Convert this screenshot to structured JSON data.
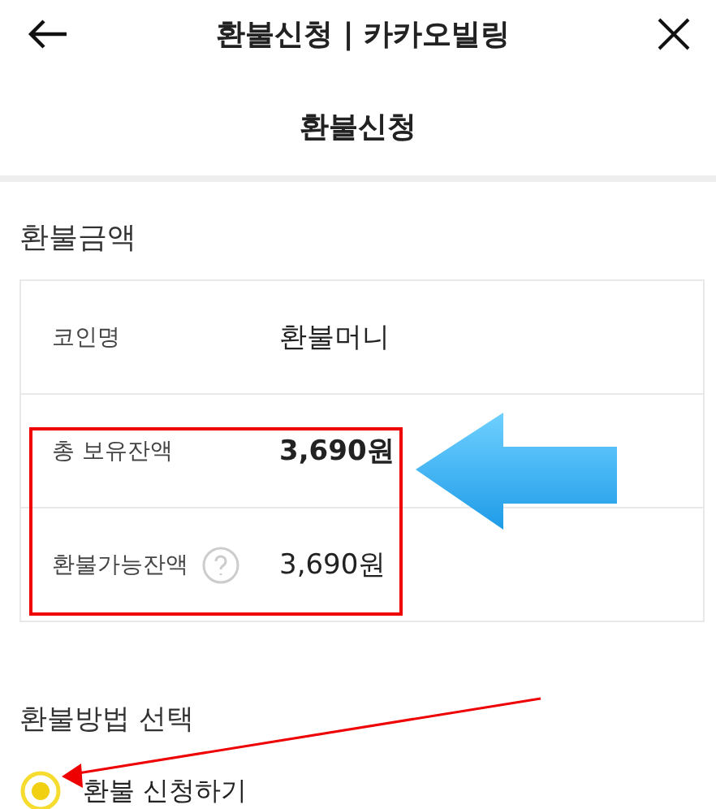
{
  "header": {
    "title": "환불신청 | 카카오빌링"
  },
  "page_title": "환불신청",
  "amount_section": {
    "heading": "환불금액",
    "rows": [
      {
        "label": "코인명",
        "value": "환불머니",
        "emphasis": false,
        "help": false
      },
      {
        "label": "총 보유잔액",
        "value": "3,690원",
        "emphasis": true,
        "help": false
      },
      {
        "label": "환불가능잔액",
        "value": "3,690원",
        "emphasis": false,
        "help": true
      }
    ]
  },
  "method_section": {
    "heading": "환불방법 선택",
    "options": [
      {
        "label": "환불 신청하기",
        "selected": true
      }
    ]
  }
}
